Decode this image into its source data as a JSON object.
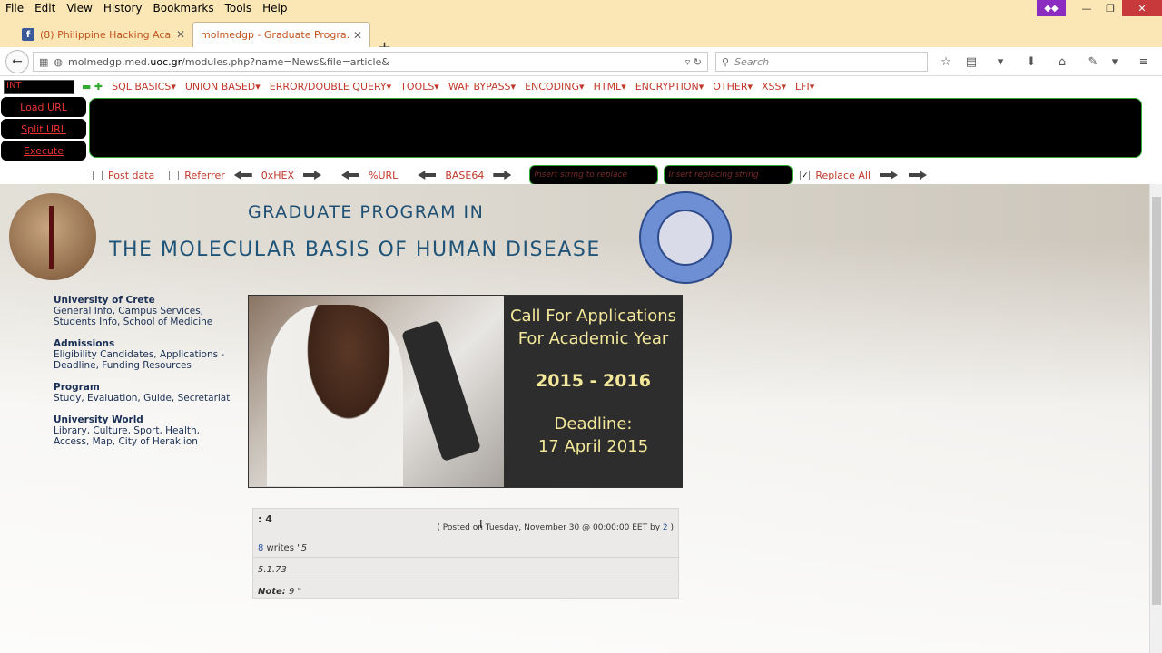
{
  "menu": [
    "File",
    "Edit",
    "View",
    "History",
    "Bookmarks",
    "Tools",
    "Help"
  ],
  "tabs": [
    {
      "title": "(8) Philippine Hacking Aca...",
      "favicon": "f"
    },
    {
      "title": "molmedgp - Graduate Progra..."
    }
  ],
  "url": {
    "prefix": "molmedgp.med.",
    "domain": "uoc.gr",
    "path": "/modules.php?name=News&file=article&"
  },
  "search_placeholder": "Search",
  "hackbar": {
    "select_value": "INT",
    "menu": [
      "SQL BASICS▾",
      "UNION BASED▾",
      "ERROR/DOUBLE QUERY▾",
      "TOOLS▾",
      "WAF BYPASS▾",
      "ENCODING▾",
      "HTML▾",
      "ENCRYPTION▾",
      "OTHER▾",
      "XSS▾",
      "LFI▾"
    ],
    "load_url": "Load URL",
    "split_url": "Split URL",
    "execute": "Execute",
    "post_data": "Post data",
    "referrer": "Referrer",
    "hex": "0xHEX",
    "url": "%URL",
    "base64": "BASE64",
    "insert_replace": "Insert string to replace",
    "insert_replacing": "Insert replacing string",
    "replace_all": "Replace All"
  },
  "site": {
    "title1": "GRADUATE  PROGRAM  IN",
    "title2": "THE  MOLECULAR  BASIS  OF  HUMAN  DISEASE",
    "nav": [
      {
        "head": "University of Crete",
        "lines": [
          "General Info, Campus Services,",
          "Students Info, School of Medicine"
        ]
      },
      {
        "head": "Admissions",
        "lines": [
          "Eligibility Candidates, Applications -",
          "Deadline, Funding Resources"
        ]
      },
      {
        "head": "Program",
        "lines": [
          "Study, Evaluation, Guide, Secretariat"
        ]
      },
      {
        "head": "University World",
        "lines": [
          "Library, Culture, Sport, Health,",
          "Access, Map, City of Heraklion"
        ]
      }
    ],
    "banner": {
      "call1": "Call For Applications",
      "call2": "For Academic Year",
      "years": "2015 - 2016",
      "deadline1": "Deadline:",
      "deadline2": "17 April 2015"
    },
    "article": {
      "title": ": 4",
      "posted_pre": "( Posted on Tuesday, November 30 @ 00:00:00 EET by ",
      "posted_by": "2",
      "posted_post": " )",
      "writes_num": "8",
      "writes_text": " writes \"",
      "writes_val": "5",
      "version": "5.1.73",
      "note_label": "Note:",
      "note_val": " 9 \""
    }
  }
}
